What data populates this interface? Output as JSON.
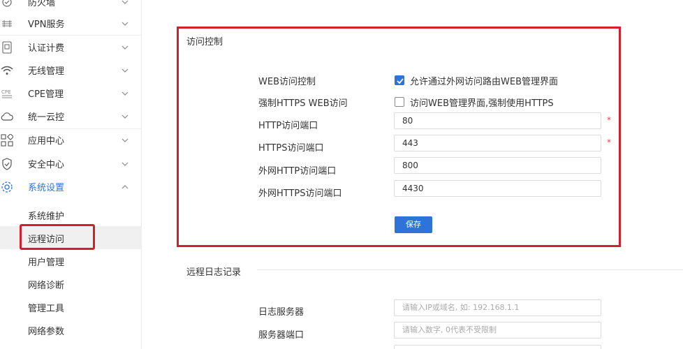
{
  "sidebar": {
    "items": [
      {
        "label": "防火墙",
        "icon": "shield-outline-icon"
      },
      {
        "label": "VPN服务",
        "icon": "vpn-icon"
      },
      {
        "label": "认证计费",
        "icon": "auth-billing-icon"
      },
      {
        "label": "无线管理",
        "icon": "wifi-icon"
      },
      {
        "label": "CPE管理",
        "icon": "cpe-icon"
      },
      {
        "label": "统一云控",
        "icon": "cloud-icon"
      },
      {
        "label": "应用中心",
        "icon": "apps-grid-icon"
      },
      {
        "label": "安全中心",
        "icon": "security-shield-icon"
      },
      {
        "label": "系统设置",
        "icon": "gear-icon"
      }
    ],
    "subitems": [
      {
        "label": "系统维护"
      },
      {
        "label": "远程访问"
      },
      {
        "label": "用户管理"
      },
      {
        "label": "网络诊断"
      },
      {
        "label": "管理工具"
      },
      {
        "label": "网络参数"
      }
    ]
  },
  "access_control": {
    "title": "访问控制",
    "web_access_label": "WEB访问控制",
    "web_access_checkbox_text": "允许通过外网访问路由WEB管理界面",
    "web_access_checked": true,
    "https_label": "强制HTTPS WEB访问",
    "https_checkbox_text": "访问WEB管理界面,强制使用HTTPS",
    "https_checked": false,
    "http_port_label": "HTTP访问端口",
    "http_port_value": "80",
    "https_port_label": "HTTPS访问端口",
    "https_port_value": "443",
    "ext_http_port_label": "外网HTTP访问端口",
    "ext_http_port_value": "800",
    "ext_https_port_label": "外网HTTPS访问端口",
    "ext_https_port_value": "4430",
    "required_mark": "*",
    "save_label": "保存"
  },
  "remote_log": {
    "title": "远程日志记录",
    "server_label": "日志服务器",
    "server_placeholder": "请输入IP或域名, 如: 192.168.1.1",
    "port_label": "服务器端口",
    "port_placeholder": "请输入数字, 0代表不受限制"
  },
  "colors": {
    "accent": "#2f73d8",
    "highlight_border": "#d21f2e",
    "required": "#e34040"
  }
}
